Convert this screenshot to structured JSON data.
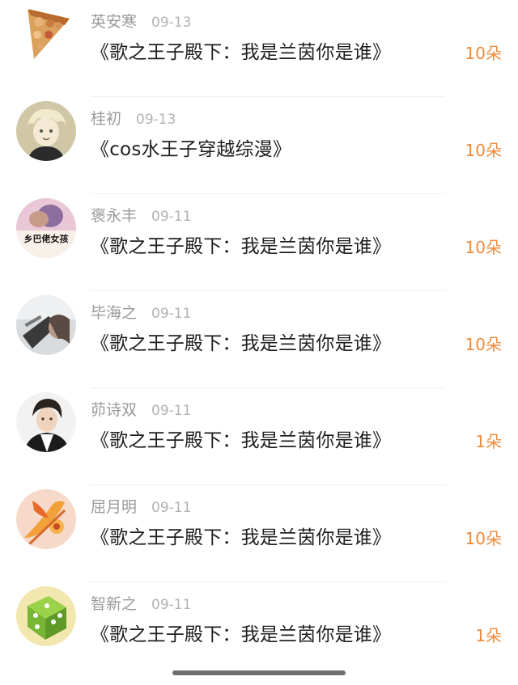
{
  "items": [
    {
      "name": "英安寒",
      "date": "09-13",
      "title": "《歌之王子殿下：我是兰茵你是谁》",
      "amount": "10朵",
      "avatar": "pizza-collage-avatar"
    },
    {
      "name": "桂初",
      "date": "09-13",
      "title": "《cos水王子穿越综漫》",
      "amount": "10朵",
      "avatar": "anime-boy-avatar"
    },
    {
      "name": "褒永丰",
      "date": "09-11",
      "title": "《歌之王子殿下：我是兰茵你是谁》",
      "amount": "10朵",
      "avatar": "meme-girl-avatar"
    },
    {
      "name": "毕海之",
      "date": "09-11",
      "title": "《歌之王子殿下：我是兰茵你是谁》",
      "amount": "10朵",
      "avatar": "gray-photo-avatar"
    },
    {
      "name": "茆诗双",
      "date": "09-11",
      "title": "《歌之王子殿下：我是兰茵你是谁》",
      "amount": "1朵",
      "avatar": "idol-boy-avatar"
    },
    {
      "name": "屈月明",
      "date": "09-11",
      "title": "《歌之王子殿下：我是兰茵你是谁》",
      "amount": "10朵",
      "avatar": "orange-flower-avatar"
    },
    {
      "name": "智新之",
      "date": "09-11",
      "title": "《歌之王子殿下：我是兰茵你是谁》",
      "amount": "1朵",
      "avatar": "green-cube-avatar"
    }
  ],
  "avatar_text": "乡巴佬女孩",
  "colors": {
    "amount": "#f08a3c",
    "meta": "#9a9a9a",
    "title": "#1f1f1f"
  }
}
